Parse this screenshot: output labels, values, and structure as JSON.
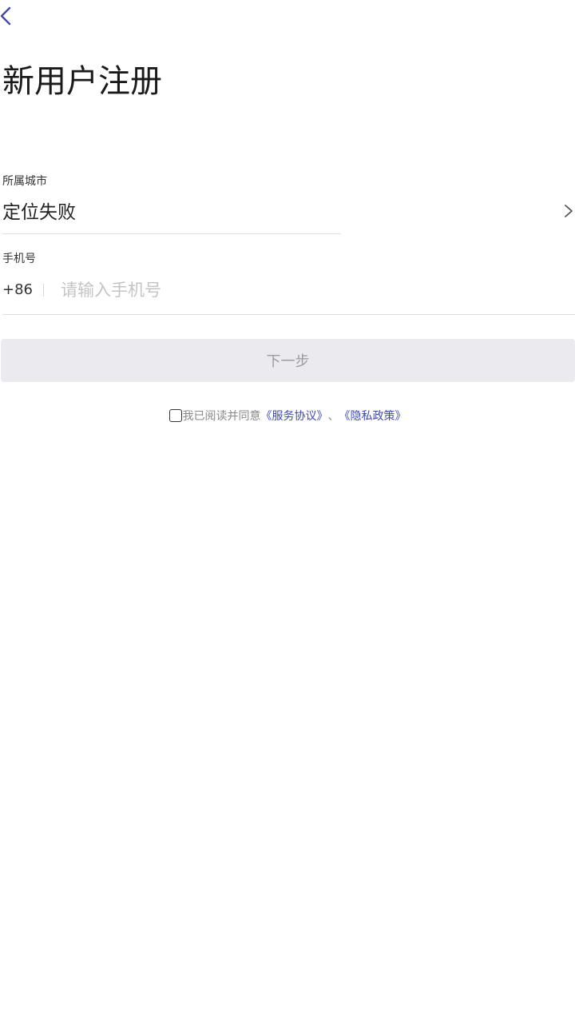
{
  "header": {
    "title": "新用户注册"
  },
  "form": {
    "city_label": "所属城市",
    "city_value": "定位失败",
    "phone_label": "手机号",
    "country_code": "+86",
    "phone_placeholder": "请输入手机号",
    "phone_value": ""
  },
  "actions": {
    "next_label": "下一步"
  },
  "agreement": {
    "checked": false,
    "prefix_text": "我已阅读并同意",
    "service_link": "《服务协议》",
    "separator": "、",
    "privacy_link": "《隐私政策》"
  },
  "colors": {
    "accent": "#3f4aa8",
    "button_bg": "#ebebef",
    "button_text": "#9a9aa0",
    "divider": "#dddddd"
  },
  "icons": {
    "back": "chevron-left-icon",
    "city_arrow": "chevron-right-icon"
  }
}
